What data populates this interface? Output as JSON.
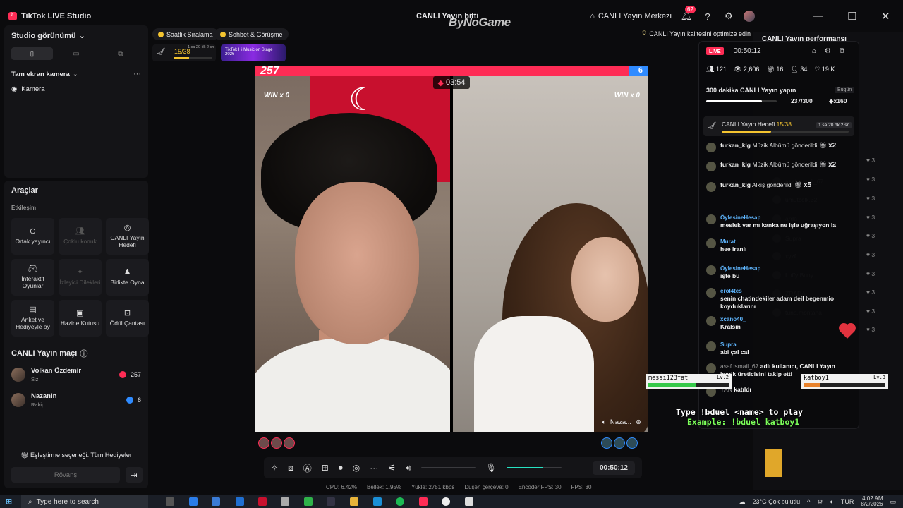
{
  "app": {
    "title": "TikTok LIVE Studio",
    "window_center": "CANLI Yayın bitti",
    "watermark": "ByNoGame",
    "center_label": "CANLI Yayın Merkezi",
    "notif_count": "62"
  },
  "left": {
    "studio_view": "Studio görünümü",
    "scene": "Tam ekran kamera",
    "source": "Kamera",
    "tools_title": "Araçlar",
    "interaction": "Etkileşim",
    "tools": [
      {
        "label": "Ortak yayıncı",
        "icon": "link-icon",
        "disabled": false
      },
      {
        "label": "Çoklu konuk",
        "icon": "multi-guest-icon",
        "disabled": true
      },
      {
        "label": "CANLI Yayın Hedefi",
        "icon": "target-icon",
        "disabled": false
      },
      {
        "label": "İnteraktif Oyunlar",
        "icon": "gamepad-icon",
        "disabled": false
      },
      {
        "label": "İzleyici Dilekleri",
        "icon": "wishes-icon",
        "disabled": true
      },
      {
        "label": "Birlikte Oyna",
        "icon": "play-together-icon",
        "disabled": false
      },
      {
        "label": "Anket ve Hediyeyle oy",
        "icon": "poll-icon",
        "disabled": false
      },
      {
        "label": "Hazine Kutusu",
        "icon": "treasure-icon",
        "disabled": false
      },
      {
        "label": "Ödül Çantası",
        "icon": "reward-bag-icon",
        "disabled": false
      }
    ],
    "match_title": "CANLI Yayın maçı",
    "players": [
      {
        "name": "Volkan Özdemir",
        "role": "Siz",
        "score": "257"
      },
      {
        "name": "Nazanin",
        "role": "Rakip",
        "score": "6"
      }
    ],
    "pairing": "Eşleştirme seçeneği: Tüm Hediyeler",
    "rematch": "Rövanş"
  },
  "top": {
    "hourly": "Saatlik Sıralama",
    "chat_meet": "Sohbet & Görüşme",
    "goal_mini": "15/38",
    "goal_mini_time": "1 sa 20 dk 2 sn",
    "music_banner": "TikTok Hi Music on Stage 2026",
    "optimize": "CANLI Yayın kalitesini optimize edin"
  },
  "battle": {
    "left_score": "257",
    "right_score": "6",
    "left_share": 0.95,
    "left_win": "WIN x 0",
    "right_win": "WIN x 0",
    "timer": "03:54",
    "right_name": "Naza..."
  },
  "controls": {
    "duration": "00:50:12",
    "volume": 0.0,
    "mic_level": 0.65
  },
  "stats": {
    "cpu": "CPU: 6.42%",
    "memory": "Bellek: 1.95%",
    "upload": "Yükle: 2751 kbps",
    "dropped": "Düşen çerçeve: 0",
    "encoder_fps": "Encoder FPS: 30",
    "fps": "FPS: 30"
  },
  "chat": {
    "live": "LIVE",
    "elapsed": "00:50:12",
    "viewers": "121",
    "views": "2,606",
    "gifts": "16",
    "follows": "34",
    "likes": "19 K",
    "goal_title": "300 dakika CANLI Yayın yapın",
    "today": "Bugün",
    "goal_progress": "237/300",
    "goal_reward": "x160",
    "goal_fraction": 0.79,
    "live_goal": "CANLI Yayın Hedefi",
    "live_goal_count": "15/38",
    "live_goal_time": "1 sa 20 dk 2 sn",
    "live_goal_fraction": 0.39,
    "messages": [
      {
        "user": "furkan_klg",
        "text": "Müzik Albümü gönderildi",
        "qty": "x2",
        "type": "gift"
      },
      {
        "user": "furkan_klg",
        "text": "Müzik Albümü gönderildi",
        "qty": "x2",
        "type": "gift"
      },
      {
        "user": "furkan_klg",
        "text": "Alkış gönderildi",
        "qty": "x5",
        "type": "gift"
      },
      {
        "user": "ÖylesineHesap",
        "text": "meslek var mı kanka ne işle uğraşıyon la",
        "type": "chat"
      },
      {
        "user": "Murat",
        "text": "hee iranlı",
        "type": "chat"
      },
      {
        "user": "ÖylesineHesap",
        "text": "işte bu",
        "type": "chat"
      },
      {
        "user": "erol4tes",
        "text": "senin chatindekiler adam deil begenmio koyduklarını",
        "type": "chat"
      },
      {
        "user": "xcano40_",
        "text": "Kralsin",
        "type": "chat"
      },
      {
        "user": "Supra",
        "text": "abi çal cal",
        "type": "chat"
      },
      {
        "user": "asaf.ismail_67",
        "text": "adlı kullanıcı, CANLI Yayın içerik üreticisini takip etti",
        "type": "system"
      },
      {
        "user": "YAN",
        "text": "katıldı",
        "type": "system"
      }
    ]
  },
  "perf": {
    "title": "CANLI Yayın performansı",
    "bg_viewers": [
      "asaf.ismail_67",
      "umutcclk.32",
      "arda",
      "Supra",
      "xyzf",
      "Luffy Buny",
      "ZRADA",
      "tuna.montana"
    ],
    "bg_likes": [
      "3",
      "3",
      "3",
      "3",
      "3",
      "3",
      "3",
      "3",
      "3",
      "3"
    ]
  },
  "overlay": {
    "p1_name": "messi123fat",
    "p1_lvl": "Lv.2",
    "p1_hp": 0.6,
    "p2_name": "katboy1",
    "p2_lvl": "Lv.3",
    "p2_hp": 0.2,
    "duel_line": "Type !bduel <name> to play",
    "example_line": "Example: !bduel katboy1"
  },
  "taskbar": {
    "search": "Type here to search",
    "weather": "23°C Çok bulutlu",
    "lang": "TUR",
    "time": "4:02 AM",
    "date": "8/2/2026"
  }
}
